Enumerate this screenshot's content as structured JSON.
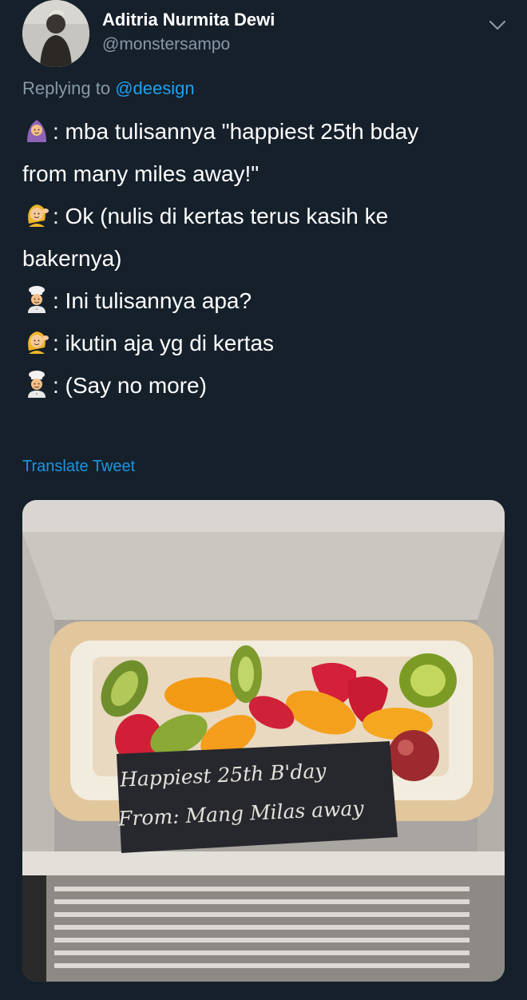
{
  "author": {
    "display_name": "Aditria Nurmita Dewi",
    "handle": "@monstersampo"
  },
  "reply": {
    "prefix": "Replying to ",
    "mention": "@deesign"
  },
  "tweet_lines": [
    {
      "emoji": "woman-headscarf-emoji",
      "text": ": mba tulisannya \"happiest 25th bday"
    },
    {
      "emoji": "",
      "text": "from many miles away!\""
    },
    {
      "emoji": "woman-tipping-hand-emoji",
      "text": ": Ok (nulis di kertas terus kasih ke"
    },
    {
      "emoji": "",
      "text": "bakernya)"
    },
    {
      "emoji": "cook-emoji",
      "text": ": Ini tulisannya apa?"
    },
    {
      "emoji": "woman-tipping-hand-emoji",
      "text": ": ikutin aja yg di kertas"
    },
    {
      "emoji": "cook-emoji",
      "text": ": (Say no more)"
    }
  ],
  "translate_label": "Translate Tweet",
  "photo": {
    "description_icon": "fruit-cake-photo",
    "plaque_line_1": "Happiest 25th B'day",
    "plaque_line_2": "From: Mang Milas away"
  },
  "colors": {
    "background": "#15202b",
    "secondary_text": "#8899a6",
    "link": "#1da1f2"
  }
}
